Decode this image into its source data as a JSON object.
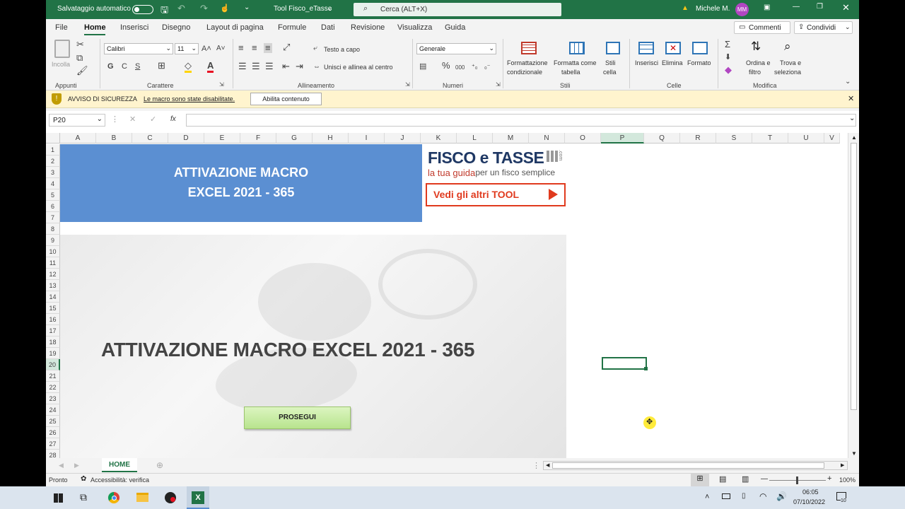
{
  "titlebar": {
    "autosave_label": "Salvataggio automatico",
    "filename": "Tool Fisco_eTasse",
    "search_placeholder": "Cerca (ALT+X)",
    "user_name": "Michele M.",
    "user_initials": "MM"
  },
  "tabs": [
    "File",
    "Home",
    "Inserisci",
    "Disegno",
    "Layout di pagina",
    "Formule",
    "Dati",
    "Revisione",
    "Visualizza",
    "Guida"
  ],
  "tabs_right": {
    "comments": "Commenti",
    "share": "Condividi"
  },
  "ribbon": {
    "paste": "Incolla",
    "font_name": "Calibri",
    "font_size": "11",
    "bold": "G",
    "italic": "C",
    "underline": "S",
    "wrap_text": "Testo a capo",
    "merge_center": "Unisci e allinea al centro",
    "number_format": "Generale",
    "cond_format": [
      "Formattazione",
      "condizionale"
    ],
    "format_table": [
      "Formatta come",
      "tabella"
    ],
    "cell_styles": [
      "Stili",
      "cella"
    ],
    "insert": "Inserisci",
    "delete": "Elimina",
    "format": "Formato",
    "sort_filter": [
      "Ordina e",
      "filtro"
    ],
    "find_select": [
      "Trova e",
      "seleziona"
    ],
    "groups": {
      "clipboard": "Appunti",
      "font": "Carattere",
      "alignment": "Allineamento",
      "number": "Numeri",
      "styles": "Stili",
      "cells": "Celle",
      "editing": "Modifica"
    }
  },
  "security_bar": {
    "title": "AVVISO DI SICUREZZA",
    "message": "Le macro sono state disabilitate.",
    "button": "Abilita contenuto"
  },
  "formula_bar": {
    "name_box": "P20",
    "fx": "fx",
    "value": ""
  },
  "columns": [
    "A",
    "B",
    "C",
    "D",
    "E",
    "F",
    "G",
    "H",
    "I",
    "J",
    "K",
    "L",
    "M",
    "N",
    "O",
    "P",
    "Q",
    "R",
    "S",
    "T",
    "U",
    "V"
  ],
  "rows": [
    "1",
    "2",
    "3",
    "4",
    "5",
    "6",
    "7",
    "8",
    "9",
    "10",
    "11",
    "12",
    "13",
    "14",
    "15",
    "16",
    "17",
    "18",
    "19",
    "20",
    "21",
    "22",
    "23",
    "24",
    "25",
    "26",
    "27",
    "28"
  ],
  "sheet_content": {
    "banner_line1": "ATTIVAZIONE MACRO",
    "banner_line2": "EXCEL 2021 - 365",
    "logo_title": "FISCO e TASSE",
    "logo_com": ".com",
    "logo_tagline_a": "la tua guida",
    "logo_tagline_b": " per un fisco semplice",
    "tool_button": "Vedi gli altri TOOL",
    "headline": "ATTIVAZIONE MACRO EXCEL 2021 - 365",
    "continue_button": "PROSEGUI"
  },
  "sheet_tabs": {
    "active": "HOME"
  },
  "status": {
    "ready": "Pronto",
    "accessibility": "Accessibilità: verifica",
    "zoom": "100%"
  },
  "taskbar": {
    "time": "06:05",
    "date": "07/10/2022",
    "notif_count": "10"
  },
  "colors": {
    "excel_green": "#217346",
    "banner_blue": "#5b8fd2",
    "logo_red": "#e03a1e",
    "button_green": "#c6efa0"
  }
}
